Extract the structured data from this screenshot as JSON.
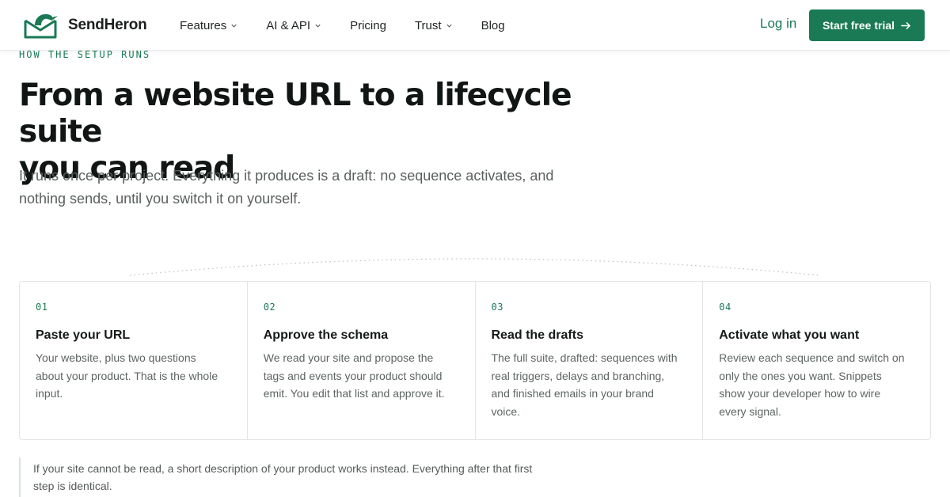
{
  "header": {
    "brand_name": "SendHeron",
    "brand_icon": "heron-envelope-logo",
    "nav": [
      {
        "label": "Features",
        "has_dropdown": true
      },
      {
        "label": "AI & API",
        "has_dropdown": true
      },
      {
        "label": "Pricing",
        "has_dropdown": false
      },
      {
        "label": "Trust",
        "has_dropdown": true
      },
      {
        "label": "Blog",
        "has_dropdown": false
      }
    ],
    "login_label": "Log in",
    "cta_label": "Start free trial",
    "cta_icon": "arrow-right-icon"
  },
  "hero": {
    "eyebrow": "HOW THE SETUP RUNS",
    "headline_line1": "From a website URL to a lifecycle suite",
    "headline_line2": "you can read",
    "lede_line1": "It runs once per project. Everything it produces is a draft: no sequence activates, and",
    "lede_line2": "nothing sends, until you switch it on yourself."
  },
  "steps": [
    {
      "num": "01",
      "title": "Paste your URL",
      "body": "Your website, plus two questions about your product. That is the whole input."
    },
    {
      "num": "02",
      "title": "Approve the schema",
      "body": "We read your site and propose the tags and events your product should emit. You edit that list and approve it."
    },
    {
      "num": "03",
      "title": "Read the drafts",
      "body": "The full suite, drafted: sequences with real triggers, delays and branching, and finished emails in your brand voice."
    },
    {
      "num": "04",
      "title": "Activate what you want",
      "body": "Review each sequence and switch on only the ones you want. Snippets show your developer how to wire every signal."
    }
  ],
  "note": {
    "line1": "If your site cannot be read, a short description of your product works instead. Everything after that first",
    "line2": "step is identical."
  },
  "colors": {
    "brand_green": "#1a7a55",
    "headline": "#111513",
    "body_text": "#5a605c",
    "border": "#e3e6e4"
  }
}
